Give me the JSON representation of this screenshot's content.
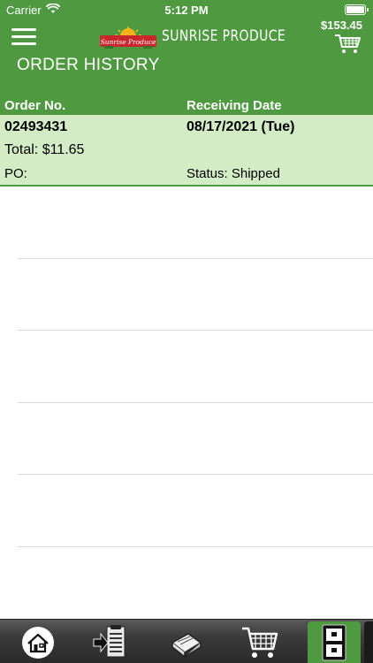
{
  "status_bar": {
    "carrier": "Carrier",
    "time": "5:12 PM"
  },
  "header": {
    "brand": "SUNRISE PRODUCE",
    "logo_script": "Sunrise Produce",
    "cart_total": "$153.45",
    "page_title": "ORDER HISTORY"
  },
  "table": {
    "columns": {
      "order_no": "Order No.",
      "receiving_date": "Receiving Date"
    },
    "orders": [
      {
        "order_no": "02493431",
        "receiving_date": "08/17/2021 (Tue)",
        "total": "Total: $11.65",
        "po": "PO:",
        "status": "Status: Shipped"
      }
    ]
  },
  "tab_bar": {
    "tabs": [
      {
        "icon": "home-icon",
        "active": false
      },
      {
        "icon": "order-guide-icon",
        "active": false
      },
      {
        "icon": "catalog-book-icon",
        "active": false
      },
      {
        "icon": "cart-icon",
        "active": false
      },
      {
        "icon": "order-history-icon",
        "active": true
      }
    ]
  },
  "colors": {
    "brand_green": "#4f9a40",
    "row_highlight": "#d4ecc5",
    "tab_bar": "#2a2a2a"
  }
}
